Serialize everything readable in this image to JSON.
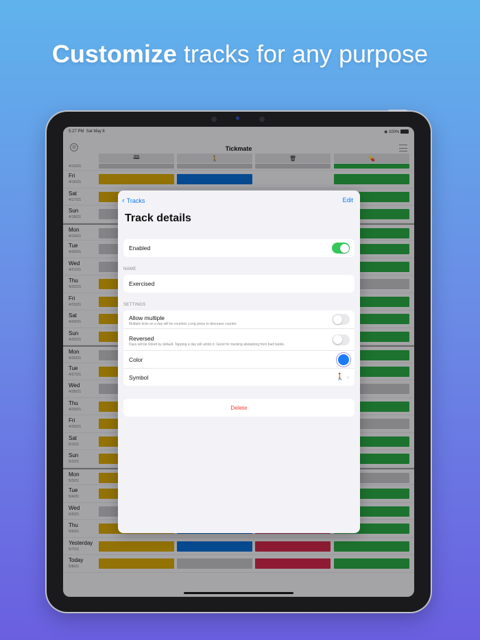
{
  "headline": {
    "bold": "Customize",
    "rest": " tracks for any purpose"
  },
  "status": {
    "time": "5:27 PM",
    "date": "Sat May 8",
    "battery": "100%"
  },
  "app": {
    "title": "Tickmate"
  },
  "track_icons": [
    "book-icon",
    "walking-icon",
    "trash-icon",
    "pills-icon"
  ],
  "colors": {
    "yellow": "#d9a90a",
    "blue": "#0a6fd6",
    "red": "#d0284d",
    "green": "#2aa845",
    "gray": "#c3c3c7"
  },
  "rows": [
    {
      "day": "",
      "date": "4/15/21",
      "cells": [
        "gray",
        "gray",
        "gray",
        "green"
      ]
    },
    {
      "day": "Fri",
      "date": "4/16/21",
      "cells": [
        "yellow",
        "blue",
        "none",
        "green"
      ]
    },
    {
      "day": "Sat",
      "date": "4/17/21",
      "cells": [
        "yellow",
        "none",
        "none",
        "green"
      ]
    },
    {
      "day": "Sun",
      "date": "4/18/21",
      "cells": [
        "gray",
        "none",
        "none",
        "green"
      ]
    },
    {
      "day": "Mon",
      "date": "4/19/21",
      "cells": [
        "gray",
        "none",
        "none",
        "green"
      ],
      "sep": true
    },
    {
      "day": "Tue",
      "date": "4/20/21",
      "cells": [
        "gray",
        "none",
        "none",
        "green"
      ]
    },
    {
      "day": "Wed",
      "date": "4/21/21",
      "cells": [
        "gray",
        "none",
        "none",
        "green"
      ]
    },
    {
      "day": "Thu",
      "date": "4/22/21",
      "cells": [
        "yellow",
        "none",
        "none",
        "gray"
      ]
    },
    {
      "day": "Fri",
      "date": "4/23/21",
      "cells": [
        "yellow",
        "none",
        "none",
        "green"
      ]
    },
    {
      "day": "Sat",
      "date": "4/24/21",
      "cells": [
        "yellow",
        "none",
        "none",
        "green"
      ]
    },
    {
      "day": "Sun",
      "date": "4/25/21",
      "cells": [
        "yellow",
        "none",
        "none",
        "green"
      ]
    },
    {
      "day": "Mon",
      "date": "4/26/21",
      "cells": [
        "gray",
        "none",
        "none",
        "green"
      ],
      "sep": true
    },
    {
      "day": "Tue",
      "date": "4/27/21",
      "cells": [
        "yellow",
        "none",
        "none",
        "green"
      ]
    },
    {
      "day": "Wed",
      "date": "4/28/21",
      "cells": [
        "gray",
        "none",
        "none",
        "gray"
      ]
    },
    {
      "day": "Thu",
      "date": "4/29/21",
      "cells": [
        "yellow",
        "none",
        "none",
        "green"
      ]
    },
    {
      "day": "Fri",
      "date": "4/30/21",
      "cells": [
        "yellow",
        "none",
        "none",
        "gray"
      ]
    },
    {
      "day": "Sat",
      "date": "5/1/21",
      "cells": [
        "yellow",
        "none",
        "none",
        "green"
      ]
    },
    {
      "day": "Sun",
      "date": "5/2/21",
      "cells": [
        "yellow",
        "none",
        "none",
        "green"
      ]
    },
    {
      "day": "Mon",
      "date": "5/3/21",
      "cells": [
        "yellow",
        "none",
        "none",
        "gray"
      ],
      "sep": true
    },
    {
      "day": "Tue",
      "date": "5/4/21",
      "cells": [
        "yellow",
        "none",
        "none",
        "green"
      ]
    },
    {
      "day": "Wed",
      "date": "5/5/21",
      "cells": [
        "gray",
        "none",
        "none",
        "green"
      ]
    },
    {
      "day": "Thu",
      "date": "5/6/21",
      "cells": [
        "yellow",
        "blue",
        "red",
        "green"
      ]
    },
    {
      "day": "Yesterday",
      "date": "5/7/21",
      "cells": [
        "yellow",
        "blue",
        "red",
        "green"
      ]
    },
    {
      "day": "Today",
      "date": "5/8/21",
      "cells": [
        "yellow",
        "gray",
        "red",
        "green"
      ]
    }
  ],
  "modal": {
    "back_label": "Tracks",
    "edit_label": "Edit",
    "title": "Track details",
    "enabled_label": "Enabled",
    "enabled": true,
    "name_section": "NAME",
    "name_value": "Exercised",
    "settings_section": "SETTINGS",
    "allow_multiple_label": "Allow multiple",
    "allow_multiple_desc": "Multiple ticks on a day will be counted. Long press to decrease counter.",
    "allow_multiple": false,
    "reversed_label": "Reversed",
    "reversed_desc": "Days will be ticked by default. Tapping a day will untick it. Good for tracking abstaining from bad habits.",
    "reversed": false,
    "color_label": "Color",
    "color_value": "#1a7cf5",
    "symbol_label": "Symbol",
    "symbol_icon": "walking-icon",
    "delete_label": "Delete"
  }
}
